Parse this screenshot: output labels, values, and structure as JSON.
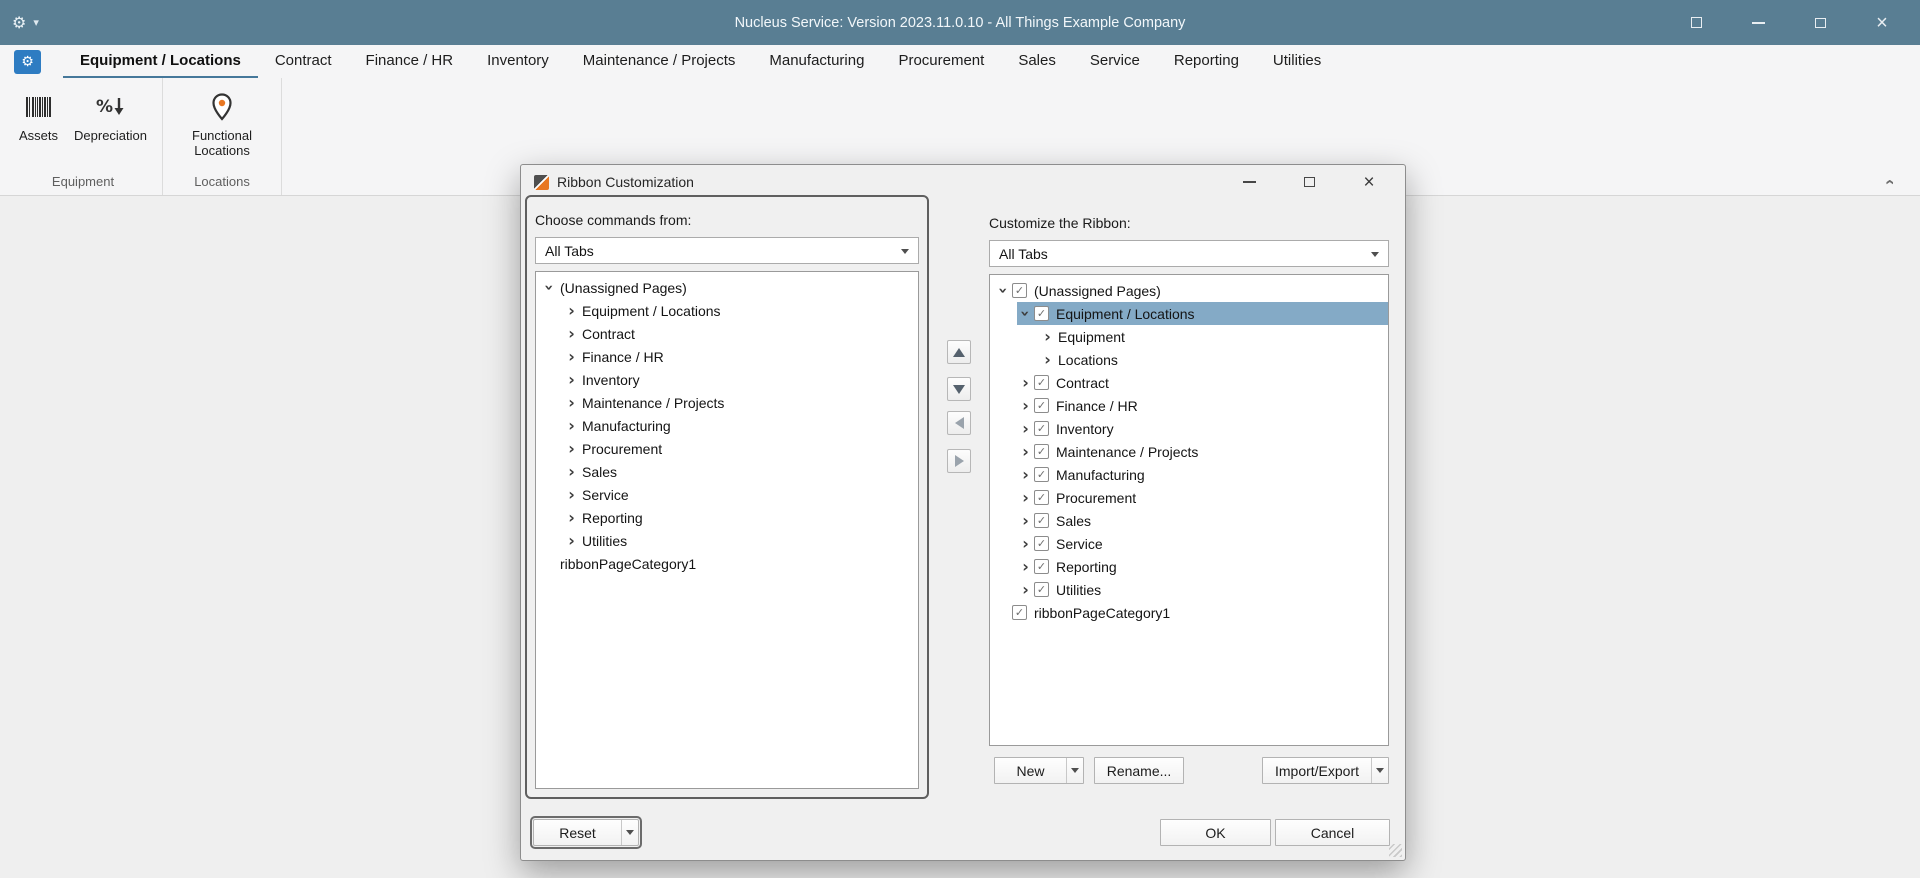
{
  "window": {
    "title": "Nucleus Service: Version 2023.11.0.10 - All Things Example Company"
  },
  "icons": {
    "gear": "⚙",
    "dropdown_caret": "▾",
    "close": "×",
    "chevron": "›",
    "check": "✓"
  },
  "ribbon": {
    "tabs": [
      {
        "label": "Equipment / Locations",
        "selected": true
      },
      {
        "label": "Contract",
        "selected": false
      },
      {
        "label": "Finance / HR",
        "selected": false
      },
      {
        "label": "Inventory",
        "selected": false
      },
      {
        "label": "Maintenance / Projects",
        "selected": false
      },
      {
        "label": "Manufacturing",
        "selected": false
      },
      {
        "label": "Procurement",
        "selected": false
      },
      {
        "label": "Sales",
        "selected": false
      },
      {
        "label": "Service",
        "selected": false
      },
      {
        "label": "Reporting",
        "selected": false
      },
      {
        "label": "Utilities",
        "selected": false
      }
    ],
    "groups": [
      {
        "label": "Equipment",
        "buttons": [
          {
            "label": "Assets",
            "icon": "barcode-icon"
          },
          {
            "label": "Depreciation",
            "icon": "percent-down-arrow-icon"
          }
        ]
      },
      {
        "label": "Locations",
        "buttons": [
          {
            "label": "Functional Locations",
            "icon": "map-pin-icon"
          }
        ]
      }
    ]
  },
  "dialog": {
    "title": "Ribbon Customization",
    "left": {
      "label": "Choose commands from:",
      "combo_value": "All Tabs",
      "tree": [
        {
          "label": "(Unassigned Pages)",
          "level": 0,
          "expander": "expanded",
          "checkbox": false,
          "selected": false
        },
        {
          "label": "Equipment / Locations",
          "level": 1,
          "expander": "collapsed",
          "checkbox": false,
          "selected": false
        },
        {
          "label": "Contract",
          "level": 1,
          "expander": "collapsed",
          "checkbox": false,
          "selected": false
        },
        {
          "label": "Finance / HR",
          "level": 1,
          "expander": "collapsed",
          "checkbox": false,
          "selected": false
        },
        {
          "label": "Inventory",
          "level": 1,
          "expander": "collapsed",
          "checkbox": false,
          "selected": false
        },
        {
          "label": "Maintenance / Projects",
          "level": 1,
          "expander": "collapsed",
          "checkbox": false,
          "selected": false
        },
        {
          "label": "Manufacturing",
          "level": 1,
          "expander": "collapsed",
          "checkbox": false,
          "selected": false
        },
        {
          "label": "Procurement",
          "level": 1,
          "expander": "collapsed",
          "checkbox": false,
          "selected": false
        },
        {
          "label": "Sales",
          "level": 1,
          "expander": "collapsed",
          "checkbox": false,
          "selected": false
        },
        {
          "label": "Service",
          "level": 1,
          "expander": "collapsed",
          "checkbox": false,
          "selected": false
        },
        {
          "label": "Reporting",
          "level": 1,
          "expander": "collapsed",
          "checkbox": false,
          "selected": false
        },
        {
          "label": "Utilities",
          "level": 1,
          "expander": "collapsed",
          "checkbox": false,
          "selected": false
        },
        {
          "label": "ribbonPageCategory1",
          "level": 0,
          "expander": null,
          "checkbox": false,
          "selected": false
        }
      ]
    },
    "middle": {
      "move_buttons": [
        "up-arrow-icon",
        "down-arrow-icon",
        "left-arrow-icon",
        "right-arrow-icon"
      ]
    },
    "right": {
      "label": "Customize the Ribbon:",
      "combo_value": "All Tabs",
      "tree": [
        {
          "label": "(Unassigned Pages)",
          "level": 0,
          "expander": "expanded",
          "checkbox": true,
          "selected": false
        },
        {
          "label": "Equipment / Locations",
          "level": 1,
          "expander": "expanded",
          "checkbox": true,
          "selected": true
        },
        {
          "label": "Equipment",
          "level": 2,
          "expander": "collapsed",
          "checkbox": false,
          "selected": false
        },
        {
          "label": "Locations",
          "level": 2,
          "expander": "collapsed",
          "checkbox": false,
          "selected": false
        },
        {
          "label": "Contract",
          "level": 1,
          "expander": "collapsed",
          "checkbox": true,
          "selected": false
        },
        {
          "label": "Finance / HR",
          "level": 1,
          "expander": "collapsed",
          "checkbox": true,
          "selected": false
        },
        {
          "label": "Inventory",
          "level": 1,
          "expander": "collapsed",
          "checkbox": true,
          "selected": false
        },
        {
          "label": "Maintenance / Projects",
          "level": 1,
          "expander": "collapsed",
          "checkbox": true,
          "selected": false
        },
        {
          "label": "Manufacturing",
          "level": 1,
          "expander": "collapsed",
          "checkbox": true,
          "selected": false
        },
        {
          "label": "Procurement",
          "level": 1,
          "expander": "collapsed",
          "checkbox": true,
          "selected": false
        },
        {
          "label": "Sales",
          "level": 1,
          "expander": "collapsed",
          "checkbox": true,
          "selected": false
        },
        {
          "label": "Service",
          "level": 1,
          "expander": "collapsed",
          "checkbox": true,
          "selected": false
        },
        {
          "label": "Reporting",
          "level": 1,
          "expander": "collapsed",
          "checkbox": true,
          "selected": false
        },
        {
          "label": "Utilities",
          "level": 1,
          "expander": "collapsed",
          "checkbox": true,
          "selected": false
        },
        {
          "label": "ribbonPageCategory1",
          "level": 0,
          "expander": null,
          "checkbox": true,
          "selected": false
        }
      ],
      "buttons": {
        "new": "New",
        "rename": "Rename...",
        "import_export": "Import/Export"
      }
    },
    "footer": {
      "reset": "Reset",
      "ok": "OK",
      "cancel": "Cancel"
    }
  }
}
